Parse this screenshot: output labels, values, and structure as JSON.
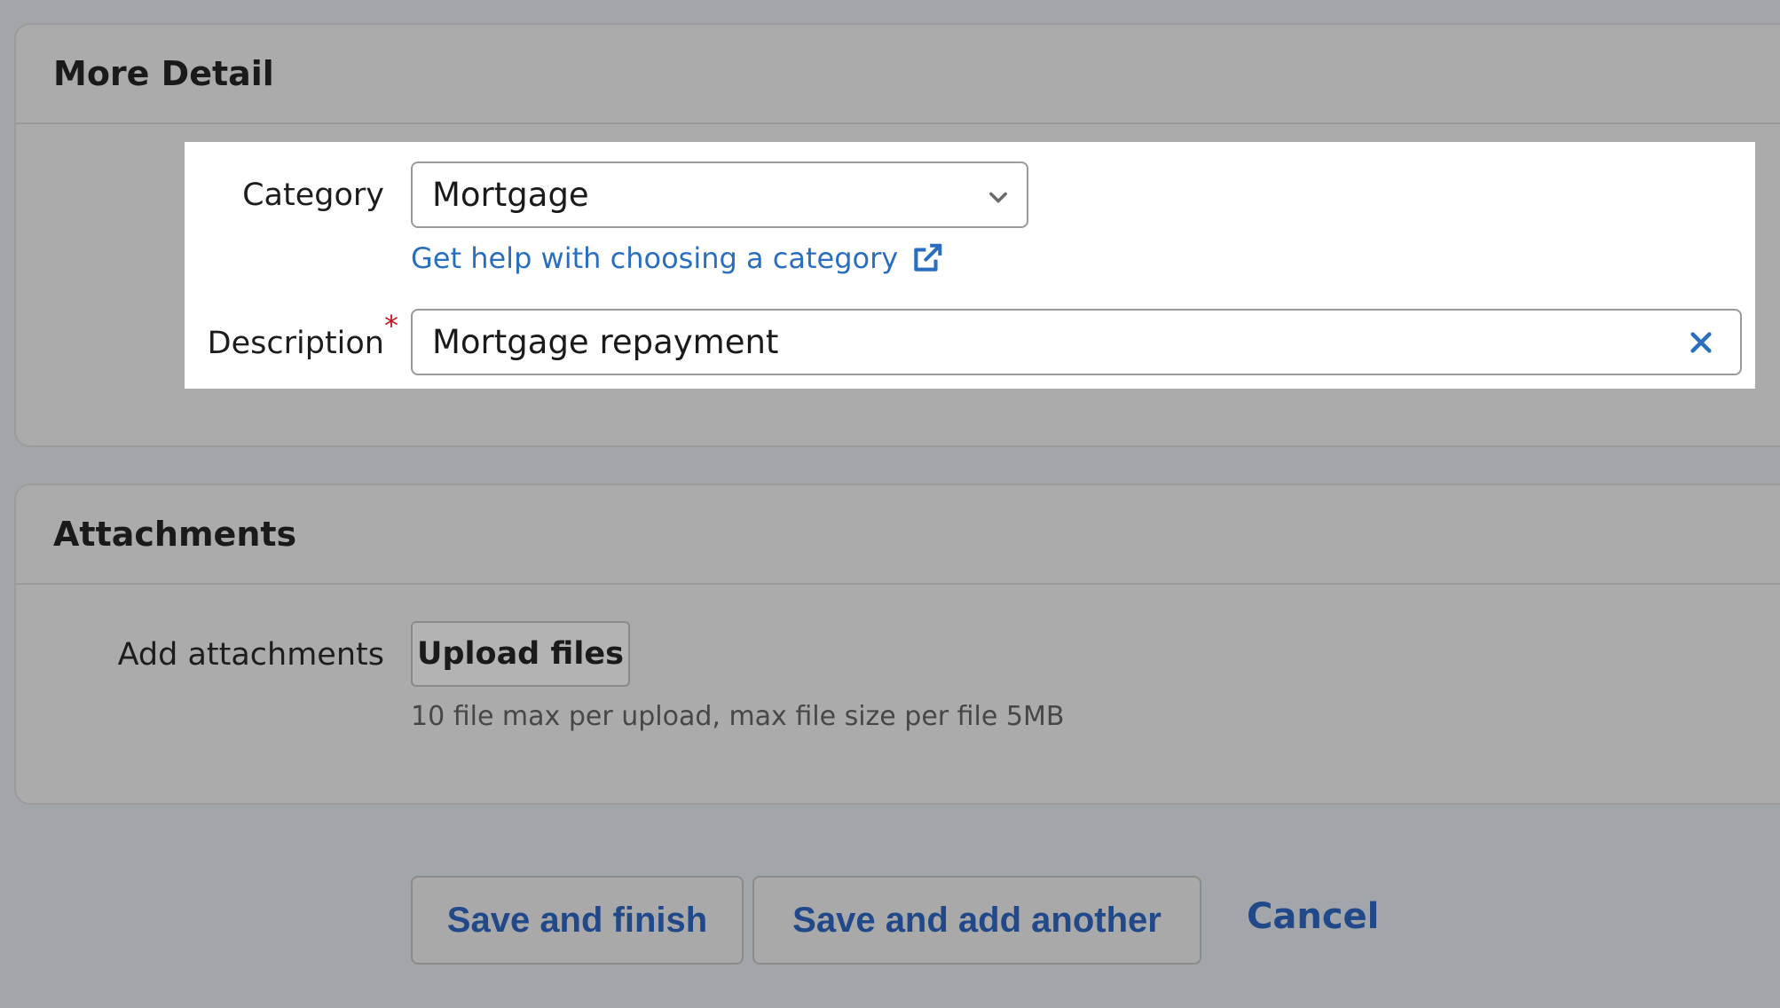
{
  "more_detail": {
    "title": "More Detail",
    "category_label": "Category",
    "category_value": "Mortgage",
    "help_link": "Get help with choosing a category",
    "description_label": "Description",
    "required_marker": "*",
    "description_value": "Mortgage repayment"
  },
  "attachments": {
    "title": "Attachments",
    "add_label": "Add attachments",
    "upload_button": "Upload files",
    "hint": "10 file max per upload, max file size per file 5MB"
  },
  "actions": {
    "save_finish": "Save and finish",
    "save_another": "Save and add another",
    "cancel": "Cancel"
  },
  "icons": {
    "dropdown": "chevron-down-icon",
    "external_link": "external-link-icon",
    "clear": "close-icon"
  },
  "colors": {
    "link": "#2a6fbf",
    "action_text": "#21498a",
    "required": "#c0181f",
    "background": "#a2a5a9"
  }
}
